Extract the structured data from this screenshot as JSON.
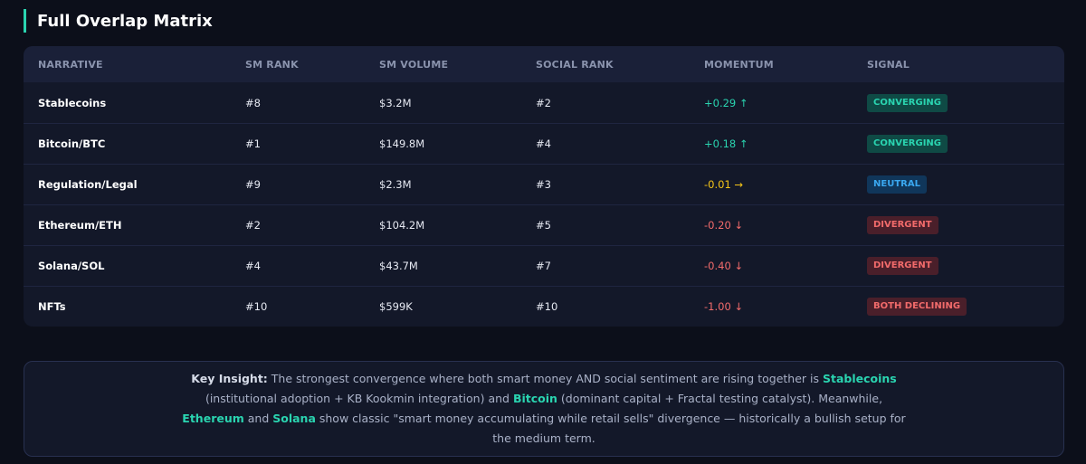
{
  "section": {
    "title": "Full Overlap Matrix"
  },
  "colors": {
    "accent": "#2ad4b0",
    "positive": "#2ad4b0",
    "neutral": "#f5c518",
    "negative": "#f26b6b"
  },
  "matrix": {
    "headers": [
      "NARRATIVE",
      "SM RANK",
      "SM VOLUME",
      "SOCIAL RANK",
      "MOMENTUM",
      "SIGNAL"
    ],
    "rows": [
      {
        "narrative": "Stablecoins",
        "sm_rank": "#8",
        "sm_volume": "$3.2M",
        "social_rank": "#2",
        "momentum": "+0.29 ↑",
        "momentum_tone": "positive",
        "signal": "CONVERGING",
        "signal_tone": "converging"
      },
      {
        "narrative": "Bitcoin/BTC",
        "sm_rank": "#1",
        "sm_volume": "$149.8M",
        "social_rank": "#4",
        "momentum": "+0.18 ↑",
        "momentum_tone": "positive",
        "signal": "CONVERGING",
        "signal_tone": "converging"
      },
      {
        "narrative": "Regulation/Legal",
        "sm_rank": "#9",
        "sm_volume": "$2.3M",
        "social_rank": "#3",
        "momentum": "-0.01 →",
        "momentum_tone": "neutral",
        "signal": "NEUTRAL",
        "signal_tone": "neutral"
      },
      {
        "narrative": "Ethereum/ETH",
        "sm_rank": "#2",
        "sm_volume": "$104.2M",
        "social_rank": "#5",
        "momentum": "-0.20 ↓",
        "momentum_tone": "negative",
        "signal": "DIVERGENT",
        "signal_tone": "divergent"
      },
      {
        "narrative": "Solana/SOL",
        "sm_rank": "#4",
        "sm_volume": "$43.7M",
        "social_rank": "#7",
        "momentum": "-0.40 ↓",
        "momentum_tone": "negative",
        "signal": "DIVERGENT",
        "signal_tone": "divergent"
      },
      {
        "narrative": "NFTs",
        "sm_rank": "#10",
        "sm_volume": "$599K",
        "social_rank": "#10",
        "momentum": "-1.00 ↓",
        "momentum_tone": "negative",
        "signal": "BOTH DECLINING",
        "signal_tone": "divergent"
      }
    ]
  },
  "insight": {
    "lead": "Key Insight:",
    "t1": " The strongest convergence where both smart money AND social sentiment are rising together is ",
    "h1": "Stablecoins",
    "t2": " (institutional adoption + KB Kookmin integration) and ",
    "h2": "Bitcoin",
    "t3": " (dominant capital + Fractal testing catalyst). Meanwhile, ",
    "h3": "Ethereum",
    "t4": " and ",
    "h4": "Solana",
    "t5": " show classic \"smart money accumulating while retail sells\" divergence — historically a bullish setup for the medium term."
  }
}
